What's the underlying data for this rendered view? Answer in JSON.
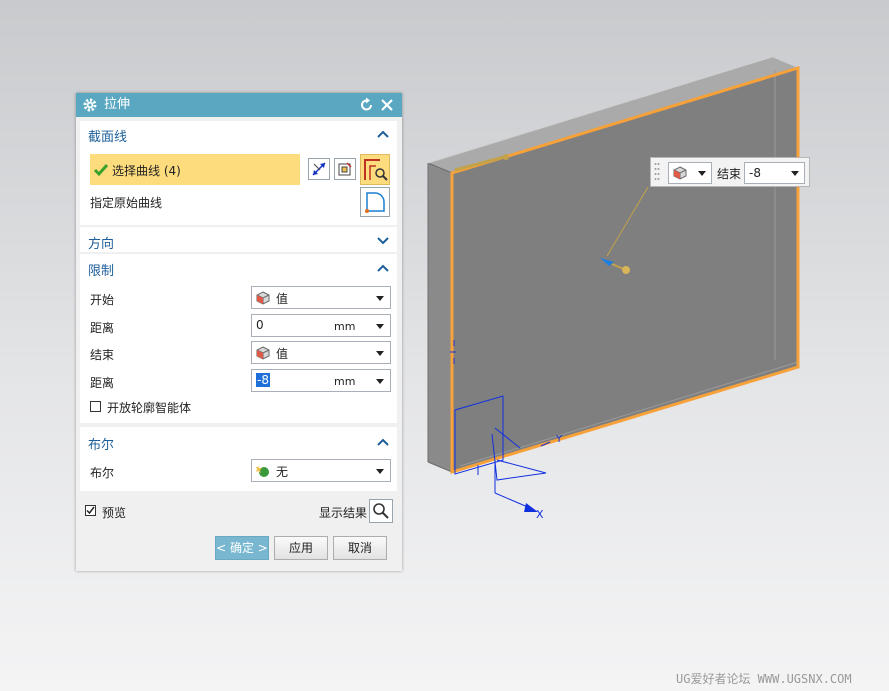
{
  "dialog": {
    "title": "拉伸",
    "sections": {
      "section_curve": {
        "title": "截面线",
        "select_curve_label": "选择曲线 (4)",
        "specify_original_label": "指定原始曲线"
      },
      "direction": {
        "title": "方向"
      },
      "limits": {
        "title": "限制",
        "start_label": "开始",
        "start_mode": "值",
        "start_distance_label": "距离",
        "start_distance": "0",
        "start_unit": "mm",
        "end_label": "结束",
        "end_mode": "值",
        "end_distance_label": "距离",
        "end_distance": "-8",
        "end_unit": "mm",
        "open_profile_label": "开放轮廓智能体",
        "open_profile_checked": false
      },
      "boolean": {
        "title": "布尔",
        "boolean_label": "布尔",
        "boolean_value": "无"
      }
    },
    "preview_label": "预览",
    "preview_checked": true,
    "show_result_label": "显示结果",
    "ok_label": "< 确定 >",
    "apply_label": "应用",
    "cancel_label": "取消"
  },
  "viewport": {
    "handle_label": "结束",
    "handle_value": "-8",
    "axis_x_label": "X",
    "axis_y_label": "Y"
  },
  "watermark": "UG爱好者论坛 WWW.UGSNX.COM",
  "colors": {
    "title_bar": "#5aa7c1",
    "section_title": "#1d5f9a",
    "selection_highlight": "#fddc7d",
    "body_orange": "#f7a13a",
    "ok_button": "#78b7cf"
  }
}
